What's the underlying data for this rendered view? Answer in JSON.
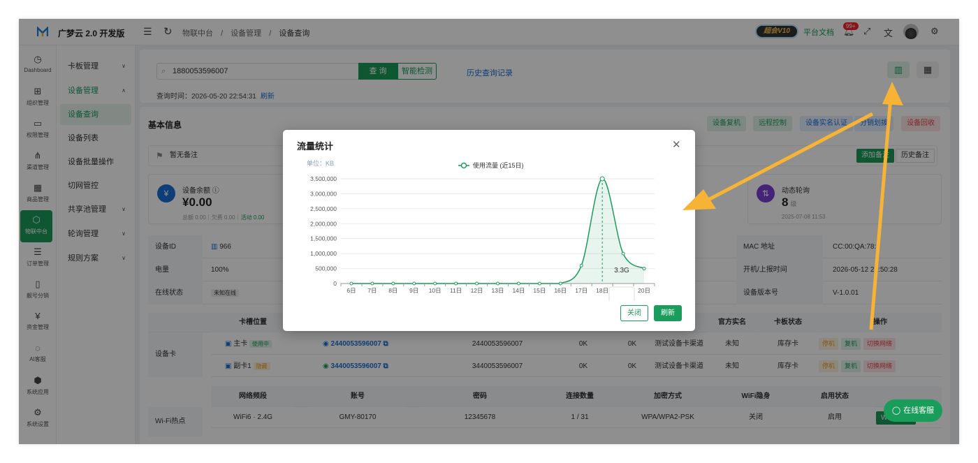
{
  "app": {
    "brand": "广梦云 2.0 开发版"
  },
  "topbar": {
    "breadcrumb": [
      "物联中台",
      "/",
      "设备管理",
      "/",
      "设备查询"
    ],
    "vip_label": "超会V10",
    "docs_label": "平台文档",
    "notify_badge": "99+"
  },
  "iconbar": [
    {
      "label": "Dashboard",
      "glyph": "◷"
    },
    {
      "label": "组织管理",
      "glyph": "⊞"
    },
    {
      "label": "权限管理",
      "glyph": "▭"
    },
    {
      "label": "渠道管理",
      "glyph": "⋔"
    },
    {
      "label": "商品管理",
      "glyph": "▦"
    },
    {
      "label": "物联中台",
      "glyph": "⬡"
    },
    {
      "label": "订单管理",
      "glyph": "☰"
    },
    {
      "label": "靓号分销",
      "glyph": "▯"
    },
    {
      "label": "资金管理",
      "glyph": "¥"
    },
    {
      "label": "AI客服",
      "glyph": "◌"
    },
    {
      "label": "系统应用",
      "glyph": "⬢"
    },
    {
      "label": "系统设置",
      "glyph": "⚙"
    }
  ],
  "menu": [
    {
      "label": "卡板管理",
      "chev": "∨"
    },
    {
      "label": "设备管理",
      "chev": "∧"
    },
    {
      "label": "设备查询",
      "chev": ""
    },
    {
      "label": "设备列表",
      "chev": ""
    },
    {
      "label": "设备批量操作",
      "chev": ""
    },
    {
      "label": "切网管控",
      "chev": ""
    },
    {
      "label": "共享池管理",
      "chev": "∨"
    },
    {
      "label": "轮询管理",
      "chev": "∨"
    },
    {
      "label": "规则方案",
      "chev": "∨"
    }
  ],
  "search": {
    "value": "1880053596007",
    "query_btn": "查 询",
    "smart_btn": "智能检测",
    "history_link": "历史查询记录",
    "time_label": "查询时间：2026-05-20 22:54:31",
    "refresh_link": "刷新"
  },
  "basic": {
    "title": "基本信息",
    "actions": [
      "设备复机",
      "远程控制",
      "设备实名认证",
      "分销划拨",
      "设备回收"
    ],
    "note": "暂无备注",
    "add_note": "添加备注",
    "history_note": "历史备注"
  },
  "stats": {
    "balance": {
      "label": "设备余额",
      "value": "¥0.00",
      "sub_a": "总额 0.00｜欠费 0.00｜",
      "sub_b": "活动 0.00"
    },
    "poll": {
      "label": "动态轮询",
      "value": "8",
      "unit": "级",
      "sub": "2025-07-08 11:53"
    }
  },
  "info_rows": [
    {
      "l1": "设备ID",
      "v1": "966",
      "l2": "MAC 地址",
      "v2": "CC:00:QA:78:8"
    },
    {
      "l1": "电量",
      "v1": "100%",
      "l2": "开机/上报时间",
      "v2": "2026-05-12 22:50:28"
    },
    {
      "l1": "在线状态",
      "v1": "未知在线",
      "l2": "设备版本号",
      "v2": "V-1.0.01"
    }
  ],
  "card_table": {
    "section": "设备卡",
    "headers": [
      "卡槽位置",
      "官方实名",
      "卡板状态",
      "操作"
    ],
    "rows": [
      {
        "slot": "主卡",
        "tag": "使用中",
        "iccid": "2440053596007",
        "iccid2": "2440053596007",
        "u1": "0K",
        "u2": "0K",
        "channel": "测试设备卡渠道",
        "realname": "未知",
        "status": "库存卡"
      },
      {
        "slot": "副卡1",
        "tag": "隐藏",
        "iccid": "3440053596007",
        "iccid2": "3440053596007",
        "u1": "0K",
        "u2": "0K",
        "channel": "测试设备卡渠道",
        "realname": "未知",
        "status": "库存卡"
      }
    ],
    "ops": [
      "停机",
      "复机",
      "切换网络"
    ]
  },
  "wifi": {
    "section": "Wi-Fi热点",
    "headers": [
      "网络频段",
      "账号",
      "密码",
      "连接数量",
      "加密方式",
      "WiFi隐身",
      "启用状态"
    ],
    "row": [
      "WiFi6 · 2.4G",
      "GMY-80170",
      "12345678",
      "1 / 31",
      "WPA/WPA2-PSK",
      "关闭",
      "启用"
    ],
    "btn": "Wi-Fi设置"
  },
  "chat_btn": "在线客服",
  "modal": {
    "title": "流量统计",
    "close_btn": "关闭",
    "refresh_btn": "刷新"
  },
  "chart_data": {
    "type": "area",
    "unit_label": "单位：KB",
    "legend": "使用流量 (近15日)",
    "categories": [
      "6日",
      "7日",
      "8日",
      "9日",
      "10日",
      "11日",
      "12日",
      "13日",
      "14日",
      "15日",
      "16日",
      "17日",
      "18日",
      "19日",
      "20日"
    ],
    "series": [
      {
        "name": "使用流量 (近15日)",
        "values": [
          0,
          0,
          0,
          0,
          0,
          0,
          0,
          0,
          0,
          0,
          0,
          600000,
          3500000,
          1000000,
          500000
        ]
      }
    ],
    "ylim": [
      0,
      3500000
    ],
    "yticks": [
      "0",
      "500,000",
      "1,000,000",
      "1,500,000",
      "2,000,000",
      "2,500,000",
      "3,000,000",
      "3,500,000"
    ],
    "tooltip": "3.3G",
    "color": "#1a9c5a"
  }
}
